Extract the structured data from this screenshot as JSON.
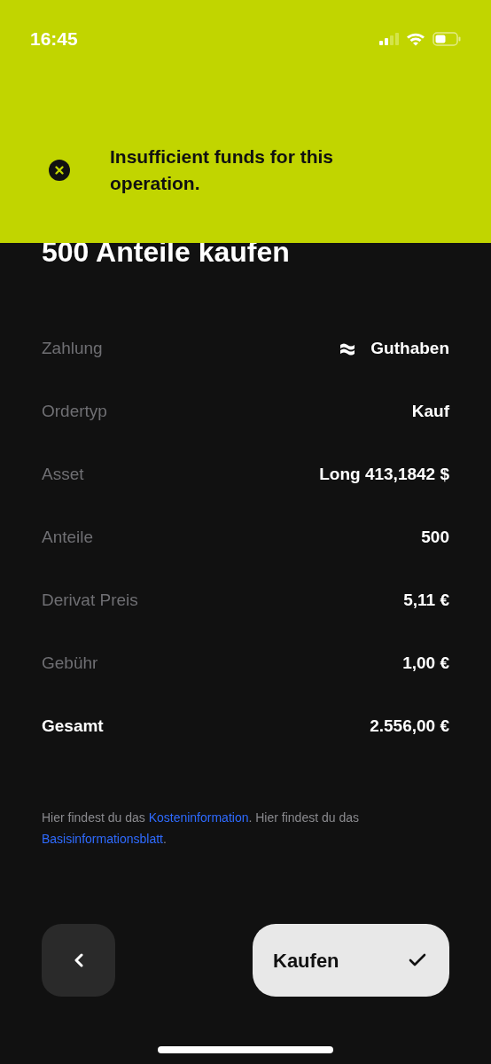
{
  "status_bar": {
    "time": "16:45"
  },
  "banner": {
    "message": "Insufficient funds for this operation."
  },
  "title": "500 Anteile kaufen",
  "rows": [
    {
      "kind": "icon",
      "label": "Zahlung",
      "value": "Guthaben"
    },
    {
      "kind": "plain",
      "label": "Ordertyp",
      "value": "Kauf"
    },
    {
      "kind": "plain",
      "label": "Asset",
      "value": "Long 413,1842 $"
    },
    {
      "kind": "plain",
      "label": "Anteile",
      "value": "500"
    },
    {
      "kind": "plain",
      "label": "Derivat Preis",
      "value": "5,11 €"
    },
    {
      "kind": "plain",
      "label": "Gebühr",
      "value": "1,00 €"
    },
    {
      "kind": "total",
      "label": "Gesamt",
      "value": "2.556,00 €"
    }
  ],
  "disclaimer": [
    {
      "kind": "text",
      "text": "Hier findest du das "
    },
    {
      "kind": "link",
      "text": "Kosteninformation"
    },
    {
      "kind": "text",
      "text": ". Hier findest du das "
    },
    {
      "kind": "link",
      "text": "Basisinformationsblatt"
    },
    {
      "kind": "text",
      "text": "."
    }
  ],
  "buy_button": {
    "label": "Kaufen"
  }
}
